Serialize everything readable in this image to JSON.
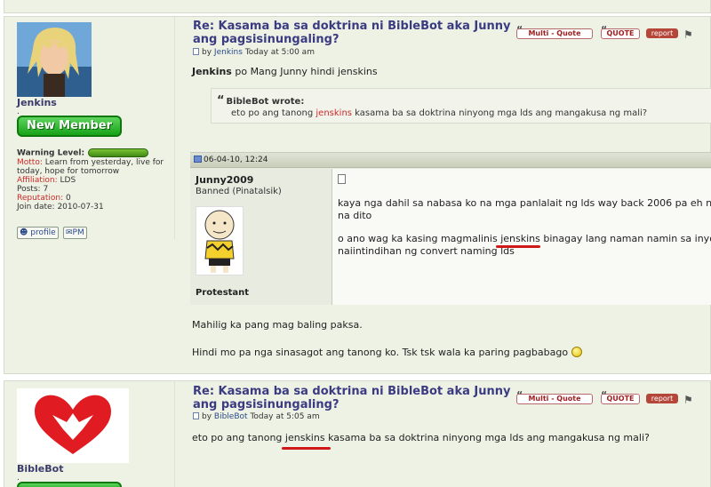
{
  "posts": [
    {
      "user": {
        "name": "Jenkins",
        "dot": ".",
        "rank": "New Member",
        "warning_label": "Warning Level:",
        "motto_label": "Motto:",
        "motto": "Learn from yesterday, live for today, hope for tomorrow",
        "affiliation_label": "Affiliation:",
        "affiliation": "LDS",
        "posts_label": "Posts:",
        "posts": "7",
        "reputation_label": "Reputation:",
        "reputation": "0",
        "join_label": "Join date:",
        "join_date": "2010-07-31",
        "profile_btn": "profile",
        "pm_btn": "PM"
      },
      "title_line1": "Re: Kasama ba sa doktrina ni BibleBot aka Junny",
      "title_line2": "ang pagsisinungaling?",
      "by": "by",
      "author": "Jenkins",
      "time": "Today at 5:00 am",
      "actions": {
        "multiquote": "Multi - Quote",
        "quote": "QUOTE",
        "report": "report"
      },
      "body_bold": "Jenkins",
      "body_rest": " po Mang Junny hindi jenskins",
      "quote": {
        "author_line": "BibleBot wrote:",
        "text_before": "eto po ang tanong ",
        "text_red": "jenskins",
        "text_after": " kasama ba sa doktrina ninyong mga lds ang mangakusa ng mali?"
      },
      "embedded": {
        "date": "06-04-10, 12:24",
        "user": "Junny2009",
        "status": "Banned (Pinatalsik)",
        "religion": "Protestant",
        "line1": "kaya nga dahil sa nabasa ko na mga panlalait ng lds way back 2006 pa eh n",
        "line2": "na dito",
        "line3": "o ano wag ka kasing magmalinis jenskins binagay lang naman namin sa inyo",
        "line4": "naiintindihan ng convert naming lds"
      },
      "reply1": "Mahilig ka pang mag baling paksa.",
      "reply2": "Hindi mo pa nga sinasagot ang tanong ko. Tsk tsk wala ka paring pagbabago"
    },
    {
      "user": {
        "name": "BibleBot",
        "dot": "."
      },
      "title_line1": "Re: Kasama ba sa doktrina ni BibleBot aka Junny",
      "title_line2": "ang pagsisinungaling?",
      "by": "by",
      "author": "BibleBot",
      "time": "Today at 5:05 am",
      "actions": {
        "multiquote": "Multi - Quote",
        "quote": "QUOTE",
        "report": "report"
      },
      "body": "eto po ang tanong jenskins kasama ba sa doktrina ninyong mga lds ang mangakusa ng mali?"
    }
  ],
  "colors": {
    "accent_red": "#d01818",
    "title": "#3b3b82",
    "post_bg": "#eef2e5",
    "rank_green": "#17a217"
  }
}
